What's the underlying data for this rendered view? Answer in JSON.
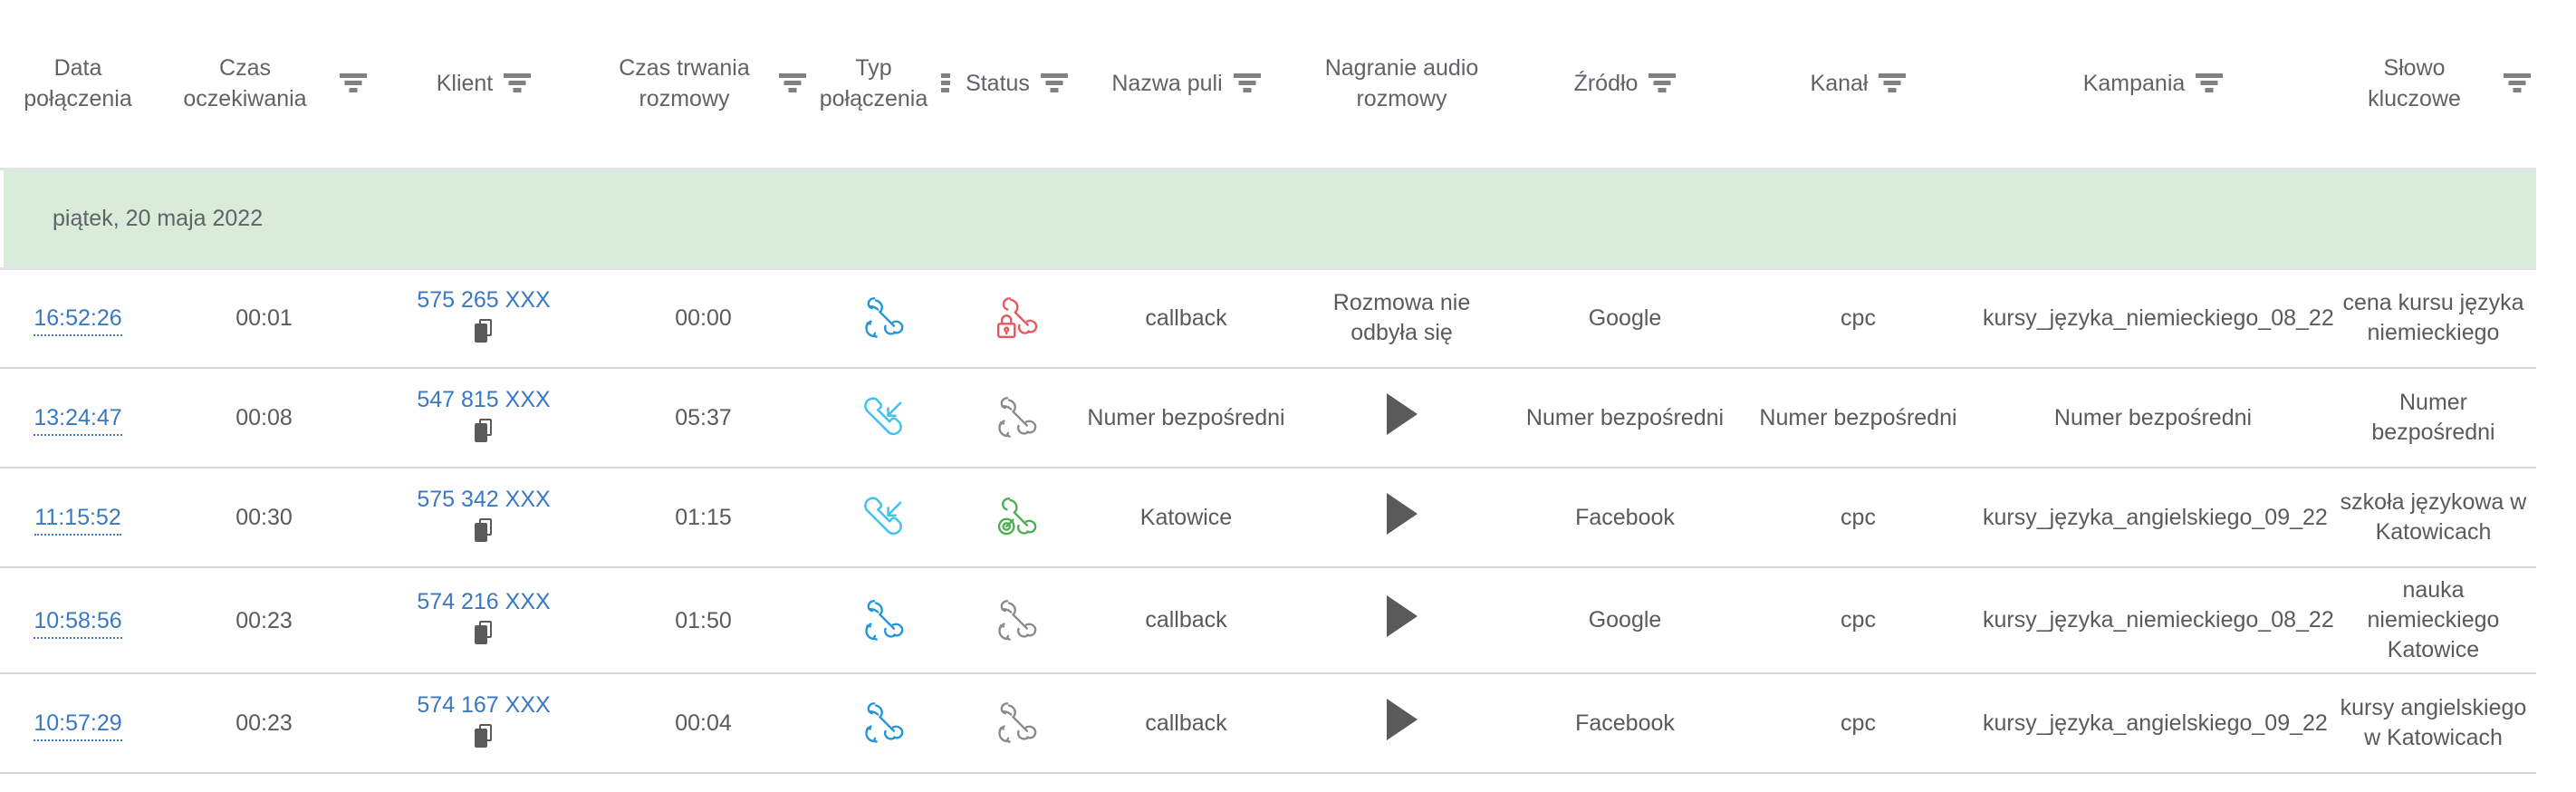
{
  "table": {
    "columns": [
      {
        "label": "Data połączenia",
        "filter": false,
        "name": "data-polaczenia"
      },
      {
        "label": "Czas oczekiwania",
        "filter": true,
        "name": "czas-oczekiwania"
      },
      {
        "label": "Klient",
        "filter": true,
        "name": "klient"
      },
      {
        "label": "Czas trwania rozmowy",
        "filter": true,
        "name": "czas-trwania-rozmowy"
      },
      {
        "label": "Typ połączenia",
        "filter": true,
        "clipped": true,
        "name": "typ-polaczenia"
      },
      {
        "label": "Status",
        "filter": true,
        "name": "status"
      },
      {
        "label": "Nazwa puli",
        "filter": true,
        "name": "nazwa-puli"
      },
      {
        "label": "Nagranie audio rozmowy",
        "filter": false,
        "name": "nagranie-audio-rozmowy"
      },
      {
        "label": "Źródło",
        "filter": true,
        "name": "zrodlo"
      },
      {
        "label": "Kanał",
        "filter": true,
        "name": "kanal"
      },
      {
        "label": "Kampania",
        "filter": true,
        "name": "kampania"
      },
      {
        "label": "Słowo kluczowe",
        "filter": true,
        "name": "slowo-kluczowe"
      }
    ],
    "date_group": "piątek, 20 maja 2022",
    "rows": [
      {
        "time": "16:52:26",
        "wait": "00:01",
        "client": "575 265 XXX",
        "duration": "00:00",
        "call_type_icon": "callback-phone-icon",
        "call_type_color": "#2196d8",
        "status_icon": "locked-phone-icon",
        "status_color": "#e8565b",
        "pool": "callback",
        "recording": "Rozmowa nie odbyła się",
        "recording_is_play": false,
        "source": "Google",
        "channel": "cpc",
        "campaign": "kursy_języka_niemieckiego_08_22",
        "keyword": "cena kursu języka niemieckiego"
      },
      {
        "time": "13:24:47",
        "wait": "00:08",
        "client": "547 815 XXX",
        "duration": "05:37",
        "call_type_icon": "incoming-call-icon",
        "call_type_color": "#45c2f0",
        "status_icon": "callback-phone-icon",
        "status_color": "#8a8a8a",
        "pool": "Numer bezpośredni",
        "recording": "",
        "recording_is_play": true,
        "source": "Numer bezpośredni",
        "channel": "Numer bezpośredni",
        "campaign": "Numer bezpośredni",
        "keyword": "Numer bezpośredni"
      },
      {
        "time": "11:15:52",
        "wait": "00:30",
        "client": "575 342 XXX",
        "duration": "01:15",
        "call_type_icon": "incoming-call-icon",
        "call_type_color": "#45c2f0",
        "status_icon": "answered-call-icon",
        "status_color": "#4caf50",
        "pool": "Katowice",
        "recording": "",
        "recording_is_play": true,
        "source": "Facebook",
        "channel": "cpc",
        "campaign": "kursy_języka_angielskiego_09_22",
        "keyword": "szkoła językowa w Katowicach"
      },
      {
        "time": "10:58:56",
        "wait": "00:23",
        "client": "574 216 XXX",
        "duration": "01:50",
        "call_type_icon": "callback-phone-icon",
        "call_type_color": "#2196d8",
        "status_icon": "callback-phone-icon",
        "status_color": "#8a8a8a",
        "pool": "callback",
        "recording": "",
        "recording_is_play": true,
        "source": "Google",
        "channel": "cpc",
        "campaign": "kursy_języka_niemieckiego_08_22",
        "keyword": "nauka niemieckiego Katowice"
      },
      {
        "time": "10:57:29",
        "wait": "00:23",
        "client": "574 167 XXX",
        "duration": "00:04",
        "call_type_icon": "callback-phone-icon",
        "call_type_color": "#2196d8",
        "status_icon": "callback-phone-icon",
        "status_color": "#8a8a8a",
        "pool": "callback",
        "recording": "",
        "recording_is_play": true,
        "source": "Facebook",
        "channel": "cpc",
        "campaign": "kursy_języka_angielskiego_09_22",
        "keyword": "kursy angielskiego w Katowicach"
      }
    ]
  },
  "colors": {
    "link": "#3a78c2",
    "date_band": "#d9ecd9",
    "header_text": "#5f6368",
    "body_text": "#5a5a5a",
    "row_border": "#d6d6d6"
  },
  "icons": {
    "filter": "filter-funnel-icon",
    "copy": "copy-icon",
    "play": "play-icon"
  }
}
